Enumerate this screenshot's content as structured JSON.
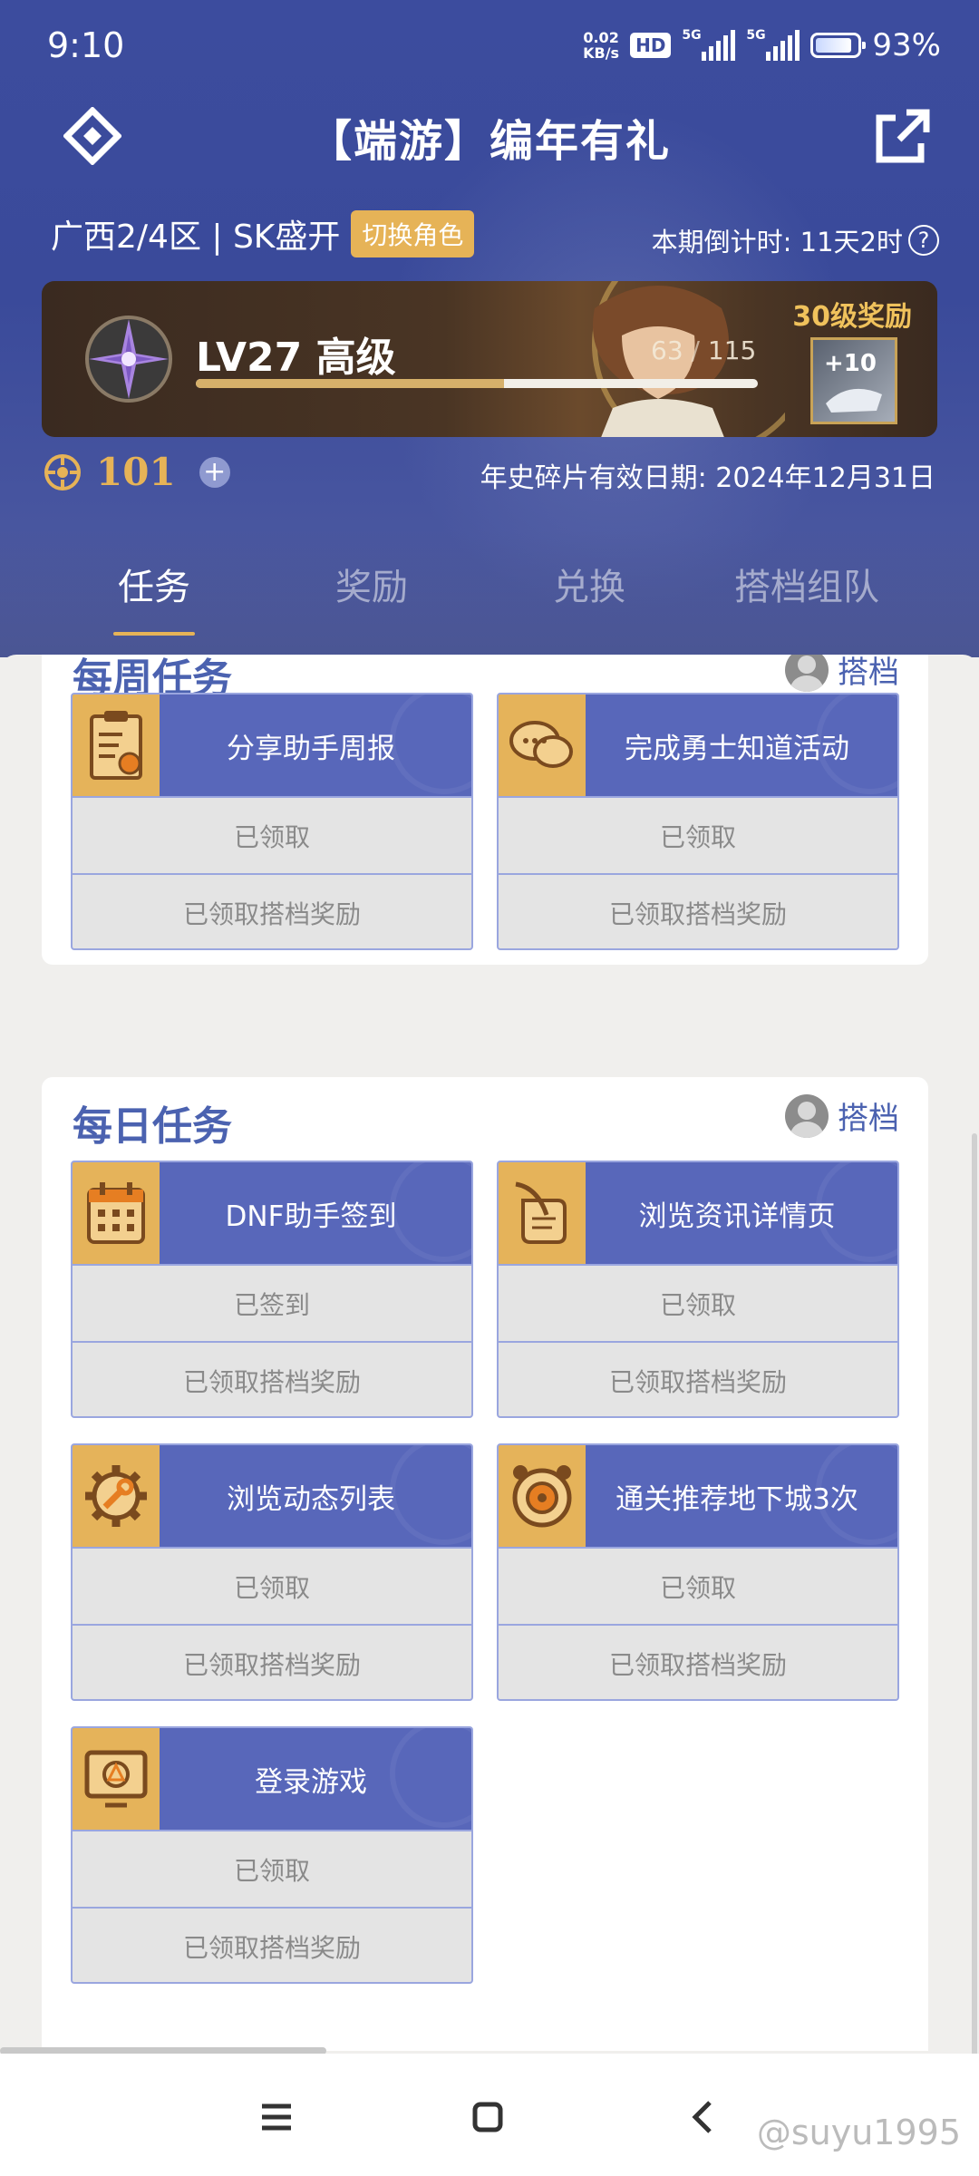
{
  "status_bar": {
    "time": "9:10",
    "net_speed_value": "0.02",
    "net_speed_unit": "KB/s",
    "hd": "HD",
    "sim1": "5G",
    "sim2": "5G",
    "battery": "93%"
  },
  "header": {
    "title": "【端游】编年有礼",
    "logo_icon": "diamond-logo-icon",
    "share_icon": "share-icon"
  },
  "role": {
    "server": "广西2/4区 | SK盛开",
    "switch_label": "切换角色",
    "countdown": "本期倒计时: 11天2时"
  },
  "level": {
    "label": "LV27 高级",
    "progress_current": "63",
    "progress_max": "115",
    "progress_fraction": 0.548,
    "reward_label": "30级奖励"
  },
  "fragments": {
    "count": "101",
    "expiry": "年史碎片有效日期: 2024年12月31日"
  },
  "tabs": [
    "任务",
    "奖励",
    "兑换",
    "搭档组队"
  ],
  "active_tab": 0,
  "weekly": {
    "title": "每周任务",
    "partner": "搭档",
    "tasks": [
      {
        "name": "分享助手周报",
        "status": "已领取",
        "partner_status": "已领取搭档奖励",
        "icon": "clipboard-icon"
      },
      {
        "name": "完成勇士知道活动",
        "status": "已领取",
        "partner_status": "已领取搭档奖励",
        "icon": "chat-bubbles-icon"
      }
    ]
  },
  "daily": {
    "title": "每日任务",
    "partner": "搭档",
    "tasks": [
      {
        "name": "DNF助手签到",
        "status": "已签到",
        "partner_status": "已领取搭档奖励",
        "icon": "calendar-icon"
      },
      {
        "name": "浏览资讯详情页",
        "status": "已领取",
        "partner_status": "已领取搭档奖励",
        "icon": "scroll-quill-icon"
      },
      {
        "name": "浏览动态列表",
        "status": "已领取",
        "partner_status": "已领取搭档奖励",
        "icon": "gear-wrench-icon"
      },
      {
        "name": "通关推荐地下城3次",
        "status": "已领取",
        "partner_status": "已领取搭档奖励",
        "icon": "dungeon-clock-icon"
      },
      {
        "name": "登录游戏",
        "status": "已领取",
        "partner_status": "已领取搭档奖励",
        "icon": "monitor-icon"
      }
    ]
  },
  "watermark": "@suyu1995",
  "colors": {
    "primary_blue": "#3c4c9e",
    "task_blue": "#5867ba",
    "gold": "#e6b357",
    "title_blue": "#4b62b0"
  }
}
